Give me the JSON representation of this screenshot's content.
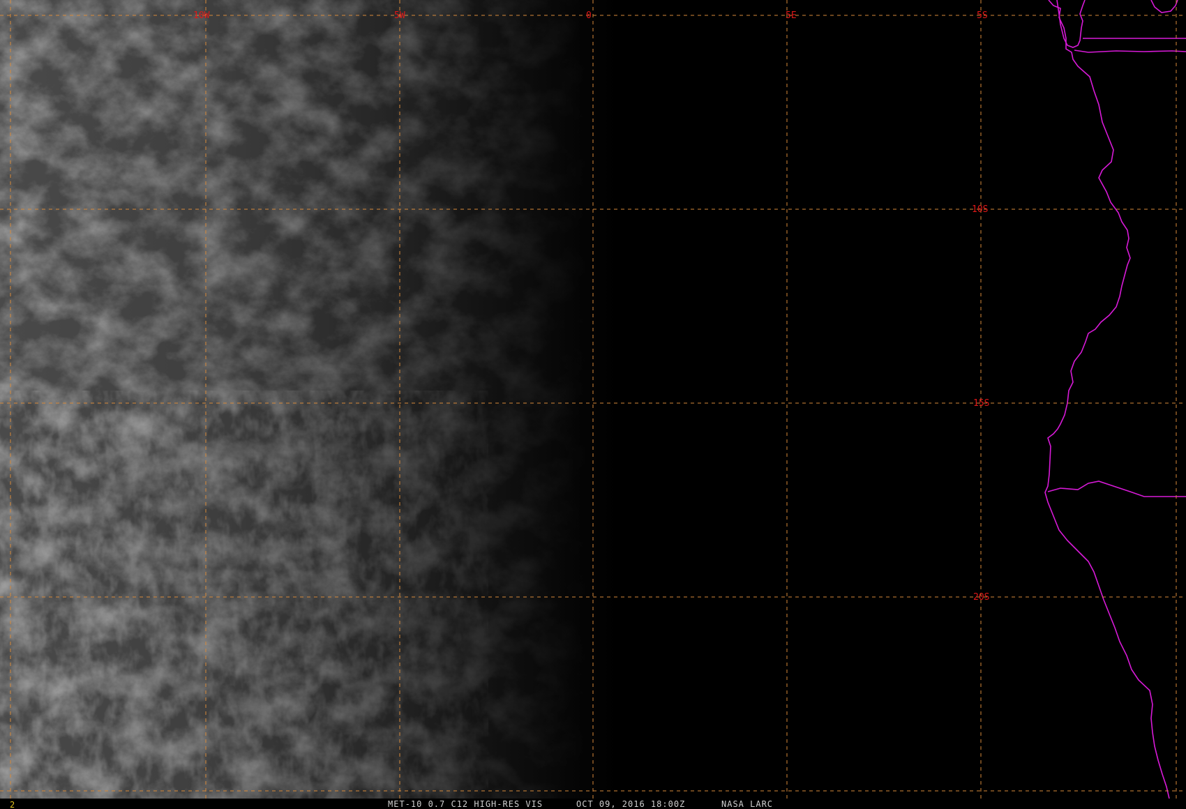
{
  "product": {
    "caption": "MET-10 0.7 C12 HIGH-RES VIS",
    "timestamp": "OCT 09, 2016 18:00Z",
    "source": "NASA LARC",
    "frame_number": "2"
  },
  "grid": {
    "longitude_labels": [
      "10W",
      "5W",
      "0",
      "5E"
    ],
    "latitude_labels": [
      "5S",
      "10S",
      "15S",
      "20S"
    ]
  },
  "colors": {
    "background": "#000000",
    "grid_line": "#d88a3a",
    "grid_label": "#e01818",
    "coastline": "#d81ad8",
    "footer_text": "#cfcfcf",
    "frame_number": "#e0c020",
    "cloud_bright": "#9a9a9a",
    "cloud_dim": "#2a2a2a"
  }
}
